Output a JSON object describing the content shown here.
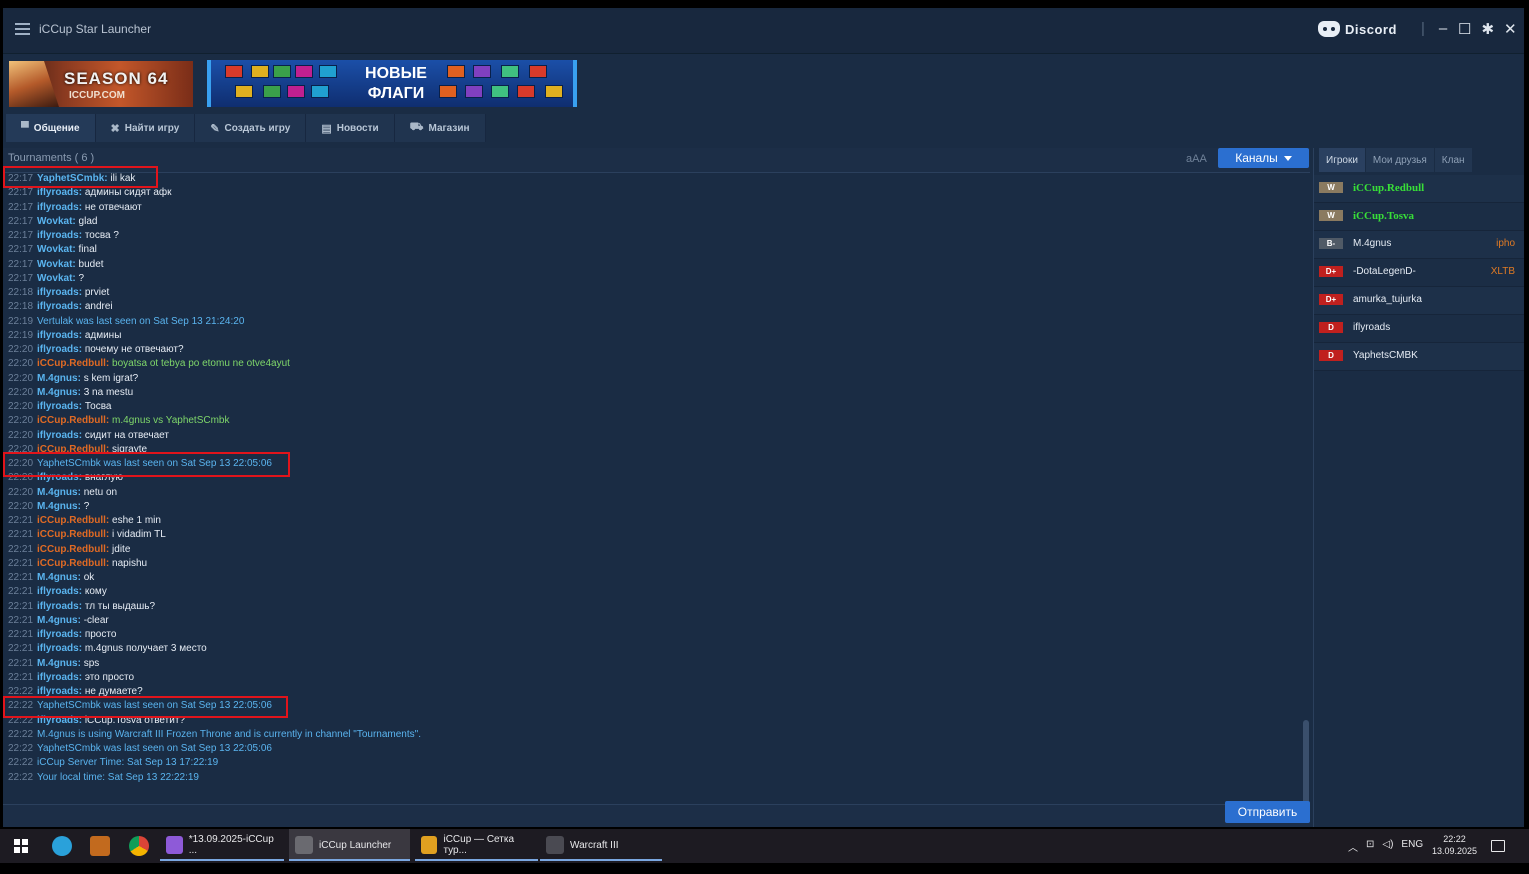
{
  "app": {
    "title": "iCCup Star Launcher",
    "discord_label": "Discord"
  },
  "banners": {
    "season_title": "SEASON 64",
    "season_site": "ICCUP.COM",
    "flags_line1": "НОВЫЕ",
    "flags_line2": "ФЛАГИ"
  },
  "tabs": [
    {
      "label": "Общение",
      "icon": "chat-icon",
      "active": true
    },
    {
      "label": "Найти игру",
      "icon": "crossed-swords-icon"
    },
    {
      "label": "Создать игру",
      "icon": "create-game-icon"
    },
    {
      "label": "Новости",
      "icon": "news-icon"
    },
    {
      "label": "Магазин",
      "icon": "cart-icon"
    }
  ],
  "chat": {
    "channel_title": "Tournaments ( 6 )",
    "font_size_label": "aAA",
    "channels_button": "Каналы",
    "send_button": "Отправить",
    "messages": [
      {
        "t": "22:17",
        "nick": "YaphetSCmbk",
        "c": "blue",
        "text": "ili kak"
      },
      {
        "t": "22:17",
        "nick": "iflyroads",
        "c": "blue",
        "text": "админы сидят афк"
      },
      {
        "t": "22:17",
        "nick": "iflyroads",
        "c": "blue",
        "text": "не отвечают"
      },
      {
        "t": "22:17",
        "nick": "Wovkat",
        "c": "blue",
        "text": "glad"
      },
      {
        "t": "22:17",
        "nick": "iflyroads",
        "c": "blue",
        "text": "тосва ?"
      },
      {
        "t": "22:17",
        "nick": "Wovkat",
        "c": "blue",
        "text": "final"
      },
      {
        "t": "22:17",
        "nick": "Wovkat",
        "c": "blue",
        "text": "budet"
      },
      {
        "t": "22:17",
        "nick": "Wovkat",
        "c": "blue",
        "text": "?"
      },
      {
        "t": "22:18",
        "nick": "iflyroads",
        "c": "blue",
        "text": "prviet"
      },
      {
        "t": "22:18",
        "nick": "iflyroads",
        "c": "blue",
        "text": "andrei"
      },
      {
        "t": "22:19",
        "sys": "Vertulak was last seen on Sat Sep 13 21:24:20"
      },
      {
        "t": "22:19",
        "nick": "iflyroads",
        "c": "blue",
        "text": "админы"
      },
      {
        "t": "22:20",
        "nick": "iflyroads",
        "c": "blue",
        "text": "почему не отвечают?"
      },
      {
        "t": "22:20",
        "nick": "iCCup.Redbull",
        "c": "orange",
        "text": "boyatsa ot tebya po etomu ne otve4ayut",
        "tc": "green"
      },
      {
        "t": "22:20",
        "nick": "M.4gnus",
        "c": "blue",
        "text": "s kem igrat?"
      },
      {
        "t": "22:20",
        "nick": "M.4gnus",
        "c": "blue",
        "text": "3 na mestu"
      },
      {
        "t": "22:20",
        "nick": "iflyroads",
        "c": "blue",
        "text": "Тосва"
      },
      {
        "t": "22:20",
        "nick": "iCCup.Redbull",
        "c": "orange",
        "text": "m.4gnus vs YaphetSCmbk",
        "tc": "green"
      },
      {
        "t": "22:20",
        "nick": "iflyroads",
        "c": "blue",
        "text": "сидит на отвечает"
      },
      {
        "t": "22:20",
        "nick": "iCCup.Redbull",
        "c": "orange",
        "text": "sigrayte"
      },
      {
        "t": "22:20",
        "sys": "YaphetSCmbk was last seen on Sat Sep 13 22:05:06"
      },
      {
        "t": "22:20",
        "nick": "iflyroads",
        "c": "blue",
        "text": "внаглую"
      },
      {
        "t": "22:20",
        "nick": "M.4gnus",
        "c": "blue",
        "text": "netu on"
      },
      {
        "t": "22:20",
        "nick": "M.4gnus",
        "c": "blue",
        "text": "?"
      },
      {
        "t": "22:21",
        "nick": "iCCup.Redbull",
        "c": "orange",
        "text": "eshe 1 min"
      },
      {
        "t": "22:21",
        "nick": "iCCup.Redbull",
        "c": "orange",
        "text": "i vidadim TL"
      },
      {
        "t": "22:21",
        "nick": "iCCup.Redbull",
        "c": "orange",
        "text": "jdite"
      },
      {
        "t": "22:21",
        "nick": "iCCup.Redbull",
        "c": "orange",
        "text": "napishu"
      },
      {
        "t": "22:21",
        "nick": "M.4gnus",
        "c": "blue",
        "text": "ok"
      },
      {
        "t": "22:21",
        "nick": "iflyroads",
        "c": "blue",
        "text": "кому"
      },
      {
        "t": "22:21",
        "nick": "iflyroads",
        "c": "blue",
        "text": "тл ты выдашь?"
      },
      {
        "t": "22:21",
        "nick": "M.4gnus",
        "c": "blue",
        "text": "-clear"
      },
      {
        "t": "22:21",
        "nick": "iflyroads",
        "c": "blue",
        "text": "просто"
      },
      {
        "t": "22:21",
        "nick": "iflyroads",
        "c": "blue",
        "text": "m.4gnus получает 3 место"
      },
      {
        "t": "22:21",
        "nick": "M.4gnus",
        "c": "blue",
        "text": "sps"
      },
      {
        "t": "22:21",
        "nick": "iflyroads",
        "c": "blue",
        "text": "это просто"
      },
      {
        "t": "22:22",
        "nick": "iflyroads",
        "c": "blue",
        "text": "не думаете?"
      },
      {
        "t": "22:22",
        "sys": "YaphetSCmbk was last seen on Sat Sep 13 22:05:06"
      },
      {
        "t": "22:22",
        "nick": "iflyroads",
        "c": "blue",
        "text": "iCCup.Tosva ответит?"
      },
      {
        "t": "22:22",
        "sys": "M.4gnus is using Warcraft III Frozen Throne and is currently in channel \"Tournaments\"."
      },
      {
        "t": "22:22",
        "sys": "YaphetSCmbk was last seen on Sat Sep 13 22:05:06"
      },
      {
        "t": "22:22",
        "sys": "iCCup Server Time: Sat Sep 13 17:22:19"
      },
      {
        "t": "22:22",
        "sys": "Your local time: Sat Sep 13 22:22:19"
      }
    ]
  },
  "players_panel": {
    "tabs": [
      "Игроки",
      "Мои друзья",
      "Клан"
    ],
    "players": [
      {
        "name": "iCCup.Redbull",
        "badge": "W",
        "badge_color": "#8a7a60",
        "green": true,
        "extra": ""
      },
      {
        "name": "iCCup.Tosva",
        "badge": "W",
        "badge_color": "#8a7a60",
        "green": true,
        "extra": ""
      },
      {
        "name": "M.4gnus",
        "badge": "B-",
        "badge_color": "#505a66",
        "green": false,
        "extra": "ipho"
      },
      {
        "name": "-DotaLegenD-",
        "badge": "D+",
        "badge_color": "#c0201e",
        "green": false,
        "extra": "XLTB"
      },
      {
        "name": "amurka_tujurka",
        "badge": "D+",
        "badge_color": "#c0201e",
        "green": false,
        "extra": ""
      },
      {
        "name": "iflyroads",
        "badge": "D",
        "badge_color": "#c0201e",
        "green": false,
        "extra": ""
      },
      {
        "name": "YaphetsCMBK",
        "badge": "D",
        "badge_color": "#c0201e",
        "green": false,
        "extra": ""
      }
    ]
  },
  "taskbar": {
    "items": [
      {
        "label": "*13.09.2025-iCCup ...",
        "color": "#8e5ad8"
      },
      {
        "label": "iCCup Launcher",
        "color": "#6a6a70",
        "active": true
      },
      {
        "label": "iCCup — Сетка тур...",
        "color": "#e0a020"
      },
      {
        "label": "Warcraft III",
        "color": "#4a4a52"
      }
    ],
    "tray_lang": "ENG",
    "clock_time": "22:22",
    "clock_date": "13.09.2025"
  }
}
